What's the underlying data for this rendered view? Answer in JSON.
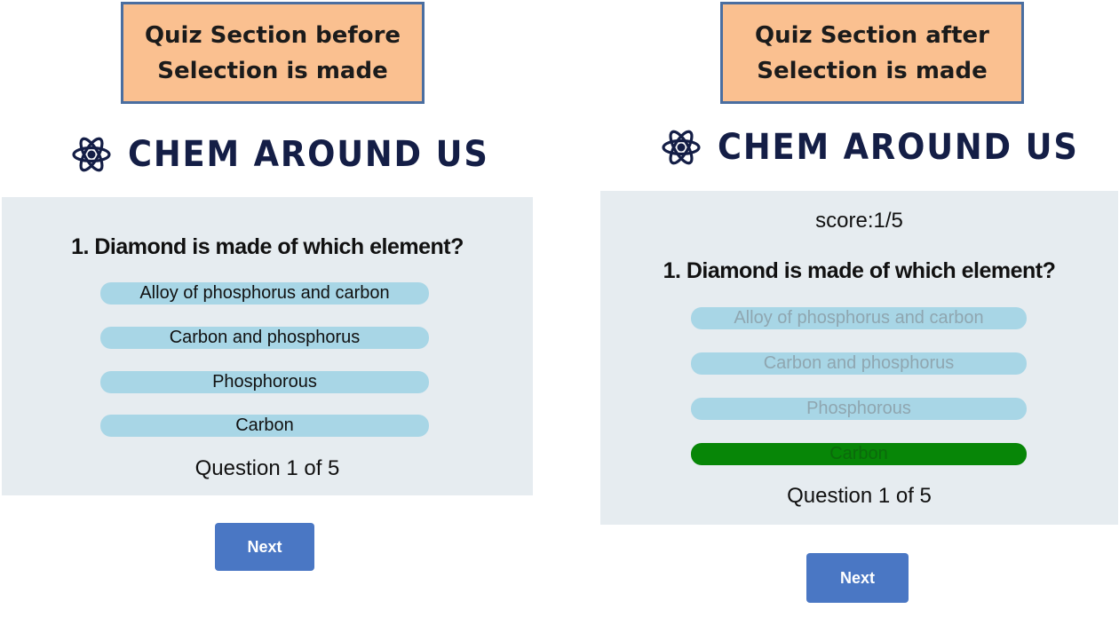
{
  "left": {
    "caption": "Quiz Section before Selection is made",
    "brand": "CHEM AROUND US",
    "question": "1. Diamond is made of which element?",
    "options": [
      "Alloy of phosphorus and carbon",
      "Carbon and phosphorus",
      "Phosphorous",
      "Carbon"
    ],
    "counter": "Question 1 of 5",
    "next_label": "Next"
  },
  "right": {
    "caption": "Quiz Section after Selection is made",
    "brand": "CHEM AROUND US",
    "score": "score:1/5",
    "question": "1. Diamond is made of which element?",
    "options": [
      "Alloy of phosphorus and carbon",
      "Carbon and phosphorus",
      "Phosphorous",
      "Carbon"
    ],
    "counter": "Question 1 of 5",
    "next_label": "Next"
  },
  "colors": {
    "caption_bg": "#fac090",
    "caption_border": "#4a6ea0",
    "brand_text": "#141e46",
    "quiz_bg": "#e6ecf0",
    "option_bg": "#a8d6e6",
    "correct_option_bg": "#078607",
    "next_button_bg": "#4a77c4"
  },
  "icons": {
    "brand": "atom-icon"
  }
}
